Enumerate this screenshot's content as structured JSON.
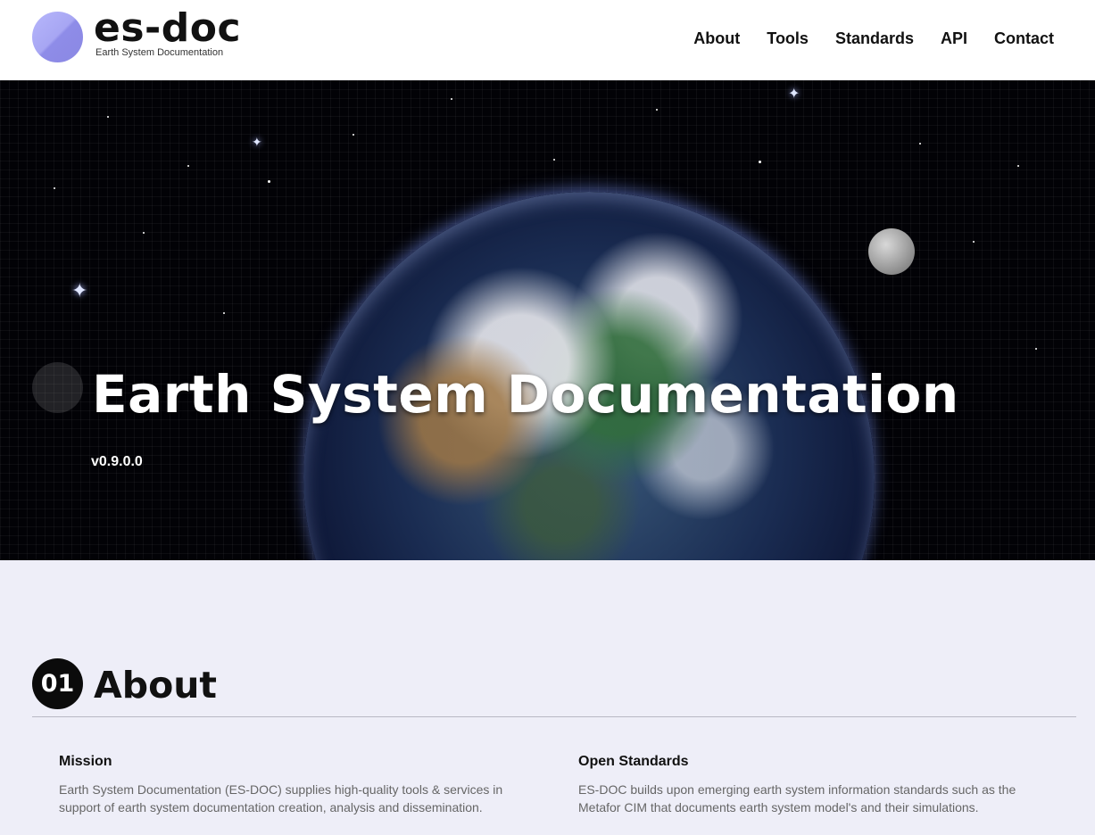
{
  "header": {
    "logo_title": "es-doc",
    "logo_subtitle": "Earth System Documentation",
    "nav": [
      {
        "label": "About"
      },
      {
        "label": "Tools"
      },
      {
        "label": "Standards"
      },
      {
        "label": "API"
      },
      {
        "label": "Contact"
      }
    ]
  },
  "hero": {
    "title": "Earth System Documentation",
    "version": "v0.9.0.0"
  },
  "about": {
    "number": "01",
    "title": "About",
    "columns": [
      {
        "heading": "Mission",
        "text": "Earth System Documentation (ES-DOC) supplies high-quality tools & services in support of earth system documentation creation, analysis and dissemination."
      },
      {
        "heading": "Open Standards",
        "text": "ES-DOC builds upon emerging earth system information standards such as the Metafor CIM that documents earth system model's and their simulations."
      }
    ]
  },
  "colors": {
    "logo_accent": "#a7a6f3",
    "page_background": "#eeeef8",
    "text_muted": "#666666"
  }
}
